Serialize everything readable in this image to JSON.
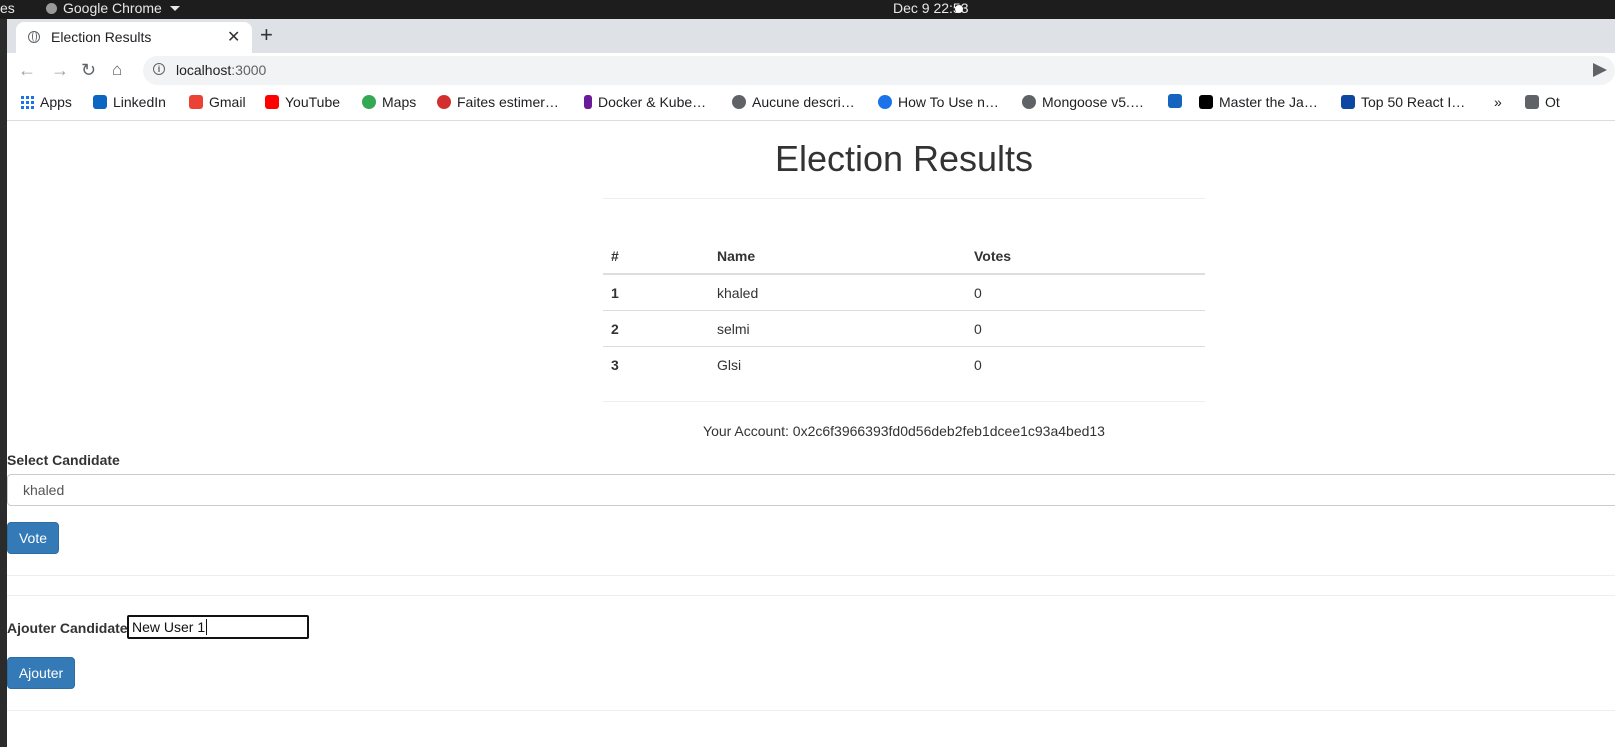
{
  "os": {
    "activities": "es",
    "app_name": "Google Chrome",
    "clock": "Dec 9  22:53"
  },
  "browser": {
    "tab_title": "Election Results",
    "url_host": "localhost",
    "url_port": ":3000",
    "bookmarks": [
      {
        "label": "Apps",
        "icon": "apps-grid-icon",
        "color": "#1a73e8"
      },
      {
        "label": "LinkedIn",
        "icon": "linkedin-icon",
        "color": "#0a66c2"
      },
      {
        "label": "Gmail",
        "icon": "gmail-icon",
        "color": "#ea4335"
      },
      {
        "label": "YouTube",
        "icon": "youtube-icon",
        "color": "#ff0000"
      },
      {
        "label": "Maps",
        "icon": "maps-icon",
        "color": "#34a853"
      },
      {
        "label": "Faites estimer…",
        "icon": "faites-icon",
        "color": "#d32f2f"
      },
      {
        "label": "Docker & Kube…",
        "icon": "docker-icon",
        "color": "#6a1b9a"
      },
      {
        "label": "Aucune descri…",
        "icon": "globe-icon",
        "color": "#5f6368"
      },
      {
        "label": "How To Use n…",
        "icon": "howto-icon",
        "color": "#1a73e8"
      },
      {
        "label": "Mongoose v5.…",
        "icon": "globe-icon",
        "color": "#5f6368"
      },
      {
        "label": "",
        "icon": "home-site-icon",
        "color": "#1565c0"
      },
      {
        "label": "Master the Ja…",
        "icon": "medium-icon",
        "color": "#000000"
      },
      {
        "label": "Top 50 React I…",
        "icon": "edureka-icon",
        "color": "#0d47a1"
      },
      {
        "label": "»",
        "icon": "more-bookmarks-icon",
        "color": "#5f6368"
      },
      {
        "label": "Ot",
        "icon": "folder-icon",
        "color": "#5f6368"
      }
    ]
  },
  "page": {
    "title": "Election Results",
    "table": {
      "headers": [
        "#",
        "Name",
        "Votes"
      ],
      "rows": [
        {
          "id": "1",
          "name": "khaled",
          "votes": "0"
        },
        {
          "id": "2",
          "name": "selmi",
          "votes": "0"
        },
        {
          "id": "3",
          "name": "Glsi",
          "votes": "0"
        }
      ]
    },
    "account": "Your Account: 0x2c6f3966393fd0d56deb2feb1dcee1c93a4bed13",
    "select_label": "Select Candidate",
    "select_value": "khaled",
    "vote_button": "Vote",
    "add_label": "Ajouter Candidate",
    "add_input_value": "New User 1",
    "add_button": "Ajouter",
    "colors": {
      "primary": "#337ab7",
      "text": "#333333"
    }
  }
}
